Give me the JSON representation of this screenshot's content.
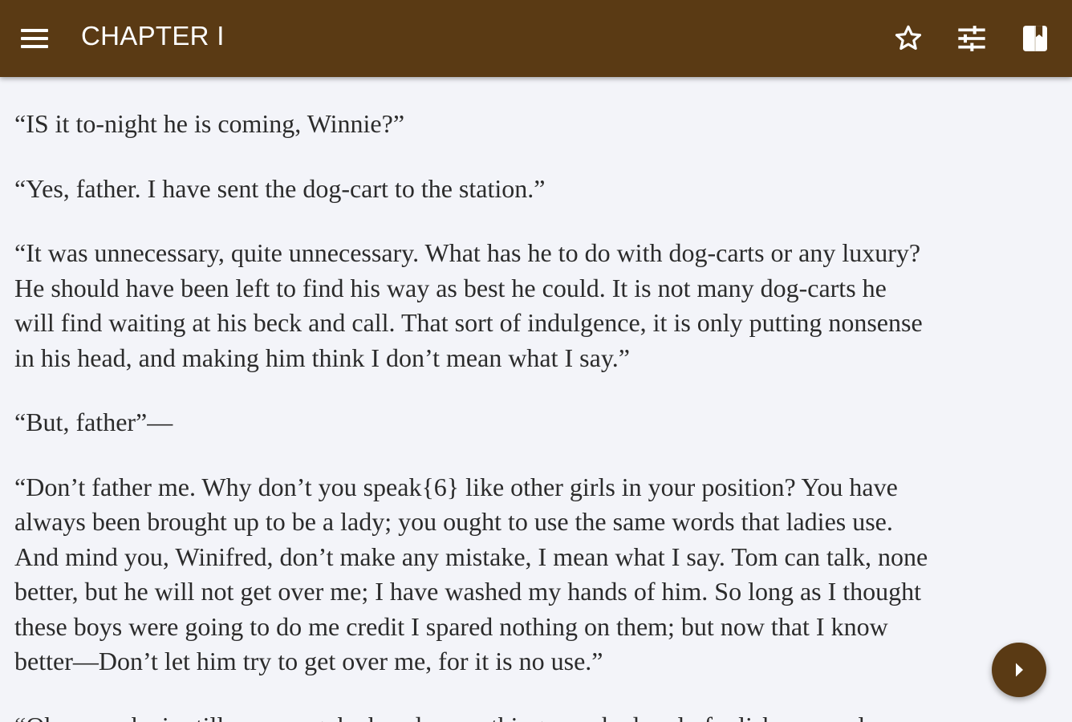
{
  "toolbar": {
    "title": "CHAPTER I",
    "icons": {
      "menu": "menu-icon",
      "bookmark": "star-outline-icon",
      "settings": "tune-sliders-icon",
      "view": "book-icon"
    },
    "color": "#5a3a14"
  },
  "reader": {
    "paragraphs": [
      "“IS it to-night he is coming, Winnie?”",
      "“Yes, father. I have sent the dog-cart to the station.”",
      "“It was unnecessary, quite unnecessary. What has he to do with dog-carts or any luxury?\nHe should have been left to find his way as best he could. It is not many dog-carts he\nwill find waiting at his beck and call. That sort of indulgence, it is only putting nonsense\nin his head, and making him think I don’t mean what I say.”",
      "“But, father”—",
      "“Don’t father me. Why don’t you speak{6} like other girls in your position? You have\nalways been brought up to be a lady; you ought to use the same words that ladies use.\nAnd mind you, Winifred, don’t make any mistake, I mean what I say. Tom can talk, none\nbetter, but he will not get over me; I have washed my hands of him. So long as I thought\nthese boys were going to do me credit I spared nothing on them; but now that I know\nbetter—Don’t let him try to get over me, for it is no use.”",
      "“Oh, papa, he is still so young; he has done nothing very bad, only foolishness, only"
    ],
    "background": "#f3f4f9",
    "text_color": "#2b2b2b"
  },
  "fab": {
    "icon": "chevron-right-icon"
  }
}
